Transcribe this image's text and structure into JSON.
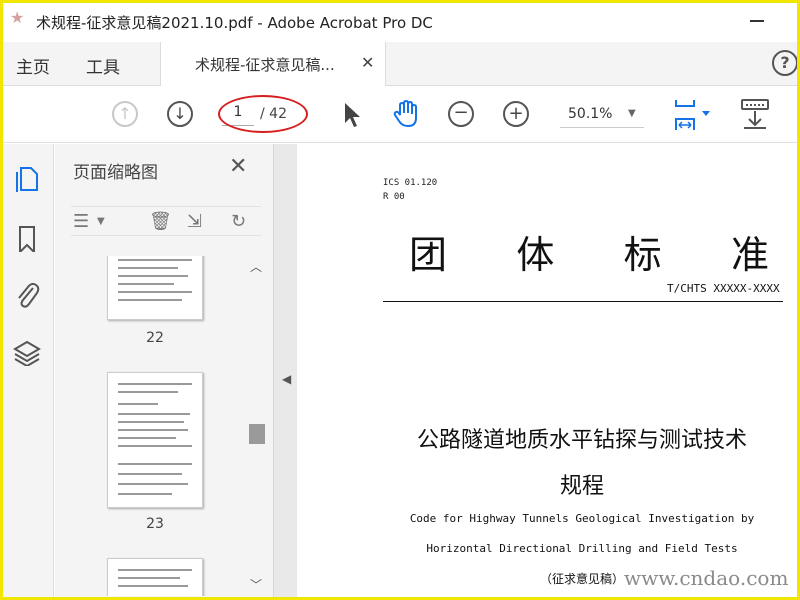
{
  "window": {
    "title": "术规程-征求意见稿2021.10.pdf - Adobe Acrobat Pro DC"
  },
  "tabs": {
    "home": "主页",
    "tools": "工具",
    "document": "术规程-征求意见稿..."
  },
  "toolbar": {
    "current_page": "1",
    "total_pages": "/ 42",
    "zoom": "50.1%"
  },
  "thumbnail_panel": {
    "title": "页面缩略图",
    "pages": [
      {
        "number": "22"
      },
      {
        "number": "23"
      }
    ]
  },
  "document": {
    "ics": "ICS 01.120",
    "r_code": "R 00",
    "standard_type": [
      "团",
      "体",
      "标",
      "准"
    ],
    "standard_number": "T/CHTS XXXXX-XXXX",
    "title_line1": "公路隧道地质水平钻探与测试技术",
    "title_line2": "规程",
    "english_line1": "Code for Highway Tunnels Geological Investigation by",
    "english_line2": "Horizontal Directional Drilling and Field Tests",
    "draft_label": "（征求意见稿）"
  },
  "watermark": "www.cndao.com",
  "colors": {
    "accent_blue": "#1473e6",
    "highlight_red": "#d62020",
    "frame_yellow": "#f2e600"
  },
  "icons": {
    "prev_page": "arrow-up-circle-icon",
    "next_page": "arrow-down-circle-icon",
    "select": "cursor-arrow-icon",
    "hand": "hand-tool-icon",
    "zoom_out": "minus-circle-icon",
    "zoom_in": "plus-circle-icon",
    "page_fit": "fit-page-icon",
    "read_mode": "read-mode-icon"
  }
}
